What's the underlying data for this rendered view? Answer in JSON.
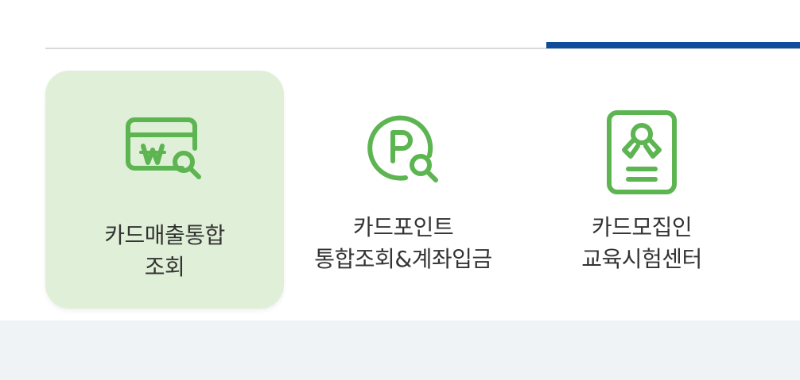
{
  "colors": {
    "accent_blue": "#0f4c9c",
    "icon_green": "#5db552",
    "active_bg": "#e0f0d8",
    "footer_bg": "#f0f3f6",
    "text": "#333333"
  },
  "menu": {
    "items": [
      {
        "icon": "card-won-search-icon",
        "line1": "카드매출통합",
        "line2": "조회",
        "active": true
      },
      {
        "icon": "point-search-icon",
        "line1": "카드포인트",
        "line2": "통합조회&계좌입금",
        "active": false
      },
      {
        "icon": "recruiter-id-card-icon",
        "line1": "카드모집인",
        "line2": "교육시험센터",
        "active": false
      }
    ]
  }
}
